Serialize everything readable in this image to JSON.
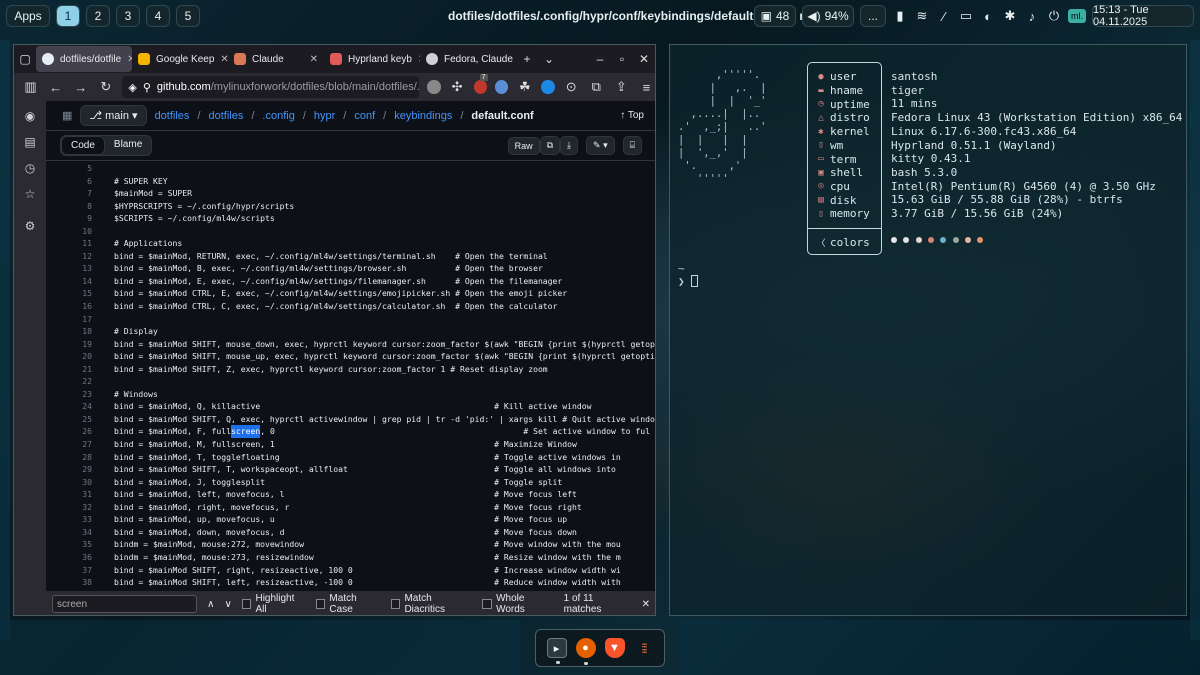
{
  "topbar": {
    "apps_label": "Apps",
    "workspaces": [
      "1",
      "2",
      "3",
      "4",
      "5"
    ],
    "active_workspace": "1",
    "window_title": "dotfiles/dotfiles/.config/hypr/conf/keybindings/default.conf at main · ...",
    "notif_count": "48",
    "volume": "94%",
    "more": "...",
    "mini_badge": "ml.",
    "clock": "15:13 - Tue 04.11.2025"
  },
  "browser": {
    "tabs": [
      {
        "label": "dotfiles/dotfile",
        "icon": "github-icon",
        "color": "#e6edf3"
      },
      {
        "label": "Google Keep",
        "icon": "keep-icon",
        "color": "#f5b400"
      },
      {
        "label": "Claude",
        "icon": "claude-icon",
        "color": "#d97757"
      },
      {
        "label": "Hyprland keyb",
        "icon": "hyprland-icon",
        "color": "#e05a5a"
      },
      {
        "label": "Fedora, Claude",
        "icon": "globe-icon",
        "color": "#cfcfd8"
      }
    ],
    "url_host": "github.com",
    "url_path": "/mylinuxforwork/dotfiles/blob/main/dotfiles/.con",
    "ext_badge": "7"
  },
  "github": {
    "branch": "main",
    "breadcrumbs": [
      "dotfiles",
      "dotfiles",
      ".config",
      "hypr",
      "conf",
      "keybindings"
    ],
    "current_file": "default.conf",
    "top_label": "Top",
    "tab_code": "Code",
    "tab_blame": "Blame",
    "raw_label": "Raw"
  },
  "code_lines": [
    {
      "n": "5",
      "t": ""
    },
    {
      "n": "6",
      "t": "# SUPER KEY"
    },
    {
      "n": "7",
      "t": "$mainMod = SUPER"
    },
    {
      "n": "8",
      "t": "$HYPRSCRIPTS = ~/.config/hypr/scripts"
    },
    {
      "n": "9",
      "t": "$SCRIPTS = ~/.config/ml4w/scripts"
    },
    {
      "n": "10",
      "t": ""
    },
    {
      "n": "11",
      "t": "# Applications"
    },
    {
      "n": "12",
      "t": "bind = $mainMod, RETURN, exec, ~/.config/ml4w/settings/terminal.sh    # Open the terminal"
    },
    {
      "n": "13",
      "t": "bind = $mainMod, B, exec, ~/.config/ml4w/settings/browser.sh          # Open the browser"
    },
    {
      "n": "14",
      "t": "bind = $mainMod, E, exec, ~/.config/ml4w/settings/filemanager.sh      # Open the filemanager"
    },
    {
      "n": "15",
      "t": "bind = $mainMod CTRL, E, exec, ~/.config/ml4w/settings/emojipicker.sh # Open the emoji picker"
    },
    {
      "n": "16",
      "t": "bind = $mainMod CTRL, C, exec, ~/.config/ml4w/settings/calculator.sh  # Open the calculator"
    },
    {
      "n": "17",
      "t": ""
    },
    {
      "n": "18",
      "t": "# Display"
    },
    {
      "n": "19",
      "t": "bind = $mainMod SHIFT, mouse_down, exec, hyprctl keyword cursor:zoom_factor $(awk \"BEGIN {print $(hyprctl getoption cu"
    },
    {
      "n": "20",
      "t": "bind = $mainMod SHIFT, mouse_up, exec, hyprctl keyword cursor:zoom_factor $(awk \"BEGIN {print $(hyprctl getoption curs"
    },
    {
      "n": "21",
      "t": "bind = $mainMod SHIFT, Z, exec, hyprctl keyword cursor:zoom_factor 1 # Reset display zoom"
    },
    {
      "n": "22",
      "t": ""
    },
    {
      "n": "23",
      "t": "# Windows"
    },
    {
      "n": "24",
      "t": "bind = $mainMod, Q, killactive                                                # Kill active window"
    },
    {
      "n": "25",
      "t": "bind = $mainMod SHIFT, Q, exec, hyprctl activewindow | grep pid | tr -d 'pid:' | xargs kill # Quit active window and a"
    },
    {
      "n": "26",
      "t": "bind = $mainMod, F, full",
      "h": "screen",
      "t2": ", 0                                                   # Set active window to ful"
    },
    {
      "n": "27",
      "t": "bind = $mainMod, M, fullscreen, 1                                             # Maximize Window"
    },
    {
      "n": "28",
      "t": "bind = $mainMod, T, togglefloating                                            # Toggle active windows in"
    },
    {
      "n": "29",
      "t": "bind = $mainMod SHIFT, T, workspaceopt, allfloat                              # Toggle all windows into"
    },
    {
      "n": "30",
      "t": "bind = $mainMod, J, togglesplit                                               # Toggle split"
    },
    {
      "n": "31",
      "t": "bind = $mainMod, left, movefocus, l                                           # Move focus left"
    },
    {
      "n": "32",
      "t": "bind = $mainMod, right, movefocus, r                                          # Move focus right"
    },
    {
      "n": "33",
      "t": "bind = $mainMod, up, movefocus, u                                             # Move focus up"
    },
    {
      "n": "34",
      "t": "bind = $mainMod, down, movefocus, d                                           # Move focus down"
    },
    {
      "n": "35",
      "t": "bindm = $mainMod, mouse:272, movewindow                                       # Move window with the mou"
    },
    {
      "n": "36",
      "t": "bindm = $mainMod, mouse:273, resizewindow                                     # Resize window with the m"
    },
    {
      "n": "37",
      "t": "bind = $mainMod SHIFT, right, resizeactive, 100 0                             # Increase window width wi"
    },
    {
      "n": "38",
      "t": "bind = $mainMod SHIFT, left, resizeactive, -100 0                             # Reduce window width with"
    },
    {
      "n": "39",
      "t": "bind = $mainMod SHIFT, down, resizeactive, 0 100                              # Increase window height w"
    }
  ],
  "findbar": {
    "query": "screen",
    "highlight_all": "Highlight All",
    "match_case": "Match Case",
    "match_diacritics": "Match Diacritics",
    "whole_words": "Whole Words",
    "result": "1 of 11 matches"
  },
  "fastfetch": {
    "rows": [
      {
        "key": "user",
        "icon": "user-icon",
        "glyph": "●",
        "value": "santosh"
      },
      {
        "key": "hname",
        "icon": "host-icon",
        "glyph": "▬",
        "value": "tiger"
      },
      {
        "key": "uptime",
        "icon": "clock-icon",
        "glyph": "◷",
        "value": "11 mins"
      },
      {
        "key": "distro",
        "icon": "distro-icon",
        "glyph": "△",
        "value": "Fedora Linux 43 (Workstation Edition) x86_64"
      },
      {
        "key": "kernel",
        "icon": "gear-icon",
        "glyph": "✱",
        "value": "Linux 6.17.6-300.fc43.x86_64"
      },
      {
        "key": "wm",
        "icon": "wm-icon",
        "glyph": "▯",
        "value": "Hyprland 0.51.1 (Wayland)"
      },
      {
        "key": "term",
        "icon": "terminal-icon",
        "glyph": "▭",
        "value": "kitty 0.43.1"
      },
      {
        "key": "shell",
        "icon": "shell-icon",
        "glyph": "▣",
        "value": "bash 5.3.0"
      },
      {
        "key": "cpu",
        "icon": "cpu-icon",
        "glyph": "◎",
        "value": "Intel(R) Pentium(R) G4560 (4) @ 3.50 GHz"
      },
      {
        "key": "disk",
        "icon": "disk-icon",
        "glyph": "▤",
        "value": "15.63 GiB / 55.88 GiB (28%) - btrfs"
      },
      {
        "key": "memory",
        "icon": "memory-icon",
        "glyph": "▯",
        "value": "3.77 GiB / 15.56 GiB (24%)"
      }
    ],
    "colors_label": "colors",
    "color_dots": [
      "#e6e6e6",
      "#e8e0dc",
      "#e8d8d0",
      "#e08070",
      "#6ab0d0",
      "#9aa89a",
      "#e0b8a0",
      "#e89070"
    ],
    "prompt_dir": "~",
    "prompt_symbol": "❯"
  },
  "dock": {
    "apps": [
      {
        "name": "terminal",
        "color": "#2a3a40",
        "glyph": "▸"
      },
      {
        "name": "firefox",
        "color": "#e66000",
        "glyph": "●"
      },
      {
        "name": "brave",
        "color": "#fb542b",
        "glyph": "▼"
      },
      {
        "name": "app-grid",
        "color": "#0c1a20",
        "glyph": "⋮⋮"
      }
    ]
  }
}
